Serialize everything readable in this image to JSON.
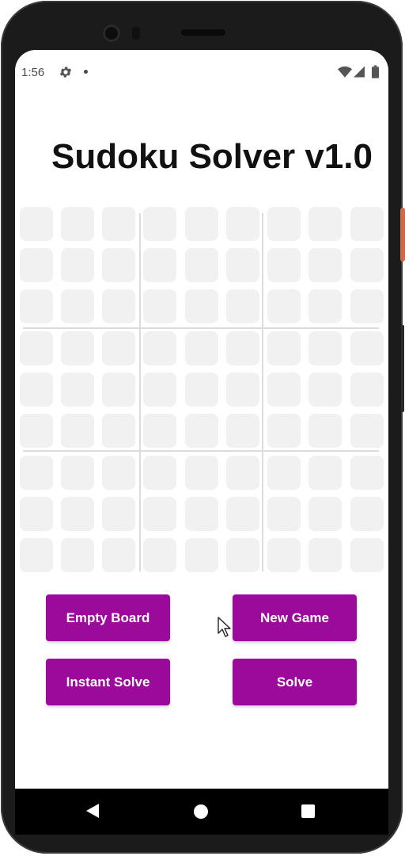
{
  "status_bar": {
    "time": "1:56",
    "icons": [
      "gear-icon",
      "notification-dot-icon",
      "wifi-icon",
      "cell-signal-icon",
      "battery-icon"
    ]
  },
  "app": {
    "title": "Sudoku Solver v1.0"
  },
  "board": {
    "rows": 9,
    "cols": 9,
    "cells": [
      [
        "",
        "",
        "",
        "",
        "",
        "",
        "",
        "",
        ""
      ],
      [
        "",
        "",
        "",
        "",
        "",
        "",
        "",
        "",
        ""
      ],
      [
        "",
        "",
        "",
        "",
        "",
        "",
        "",
        "",
        ""
      ],
      [
        "",
        "",
        "",
        "",
        "",
        "",
        "",
        "",
        ""
      ],
      [
        "",
        "",
        "",
        "",
        "",
        "",
        "",
        "",
        ""
      ],
      [
        "",
        "",
        "",
        "",
        "",
        "",
        "",
        "",
        ""
      ],
      [
        "",
        "",
        "",
        "",
        "",
        "",
        "",
        "",
        ""
      ],
      [
        "",
        "",
        "",
        "",
        "",
        "",
        "",
        "",
        ""
      ],
      [
        "",
        "",
        "",
        "",
        "",
        "",
        "",
        "",
        ""
      ]
    ]
  },
  "buttons": {
    "empty_board": "Empty Board",
    "new_game": "New Game",
    "instant_solve": "Instant Solve",
    "solve": "Solve"
  },
  "nav_bar": {
    "icons": [
      "back-icon",
      "home-icon",
      "recents-icon"
    ]
  },
  "colors": {
    "accent": "#9c0a9c",
    "cell_background": "#f1f1f1",
    "title": "#111111"
  }
}
